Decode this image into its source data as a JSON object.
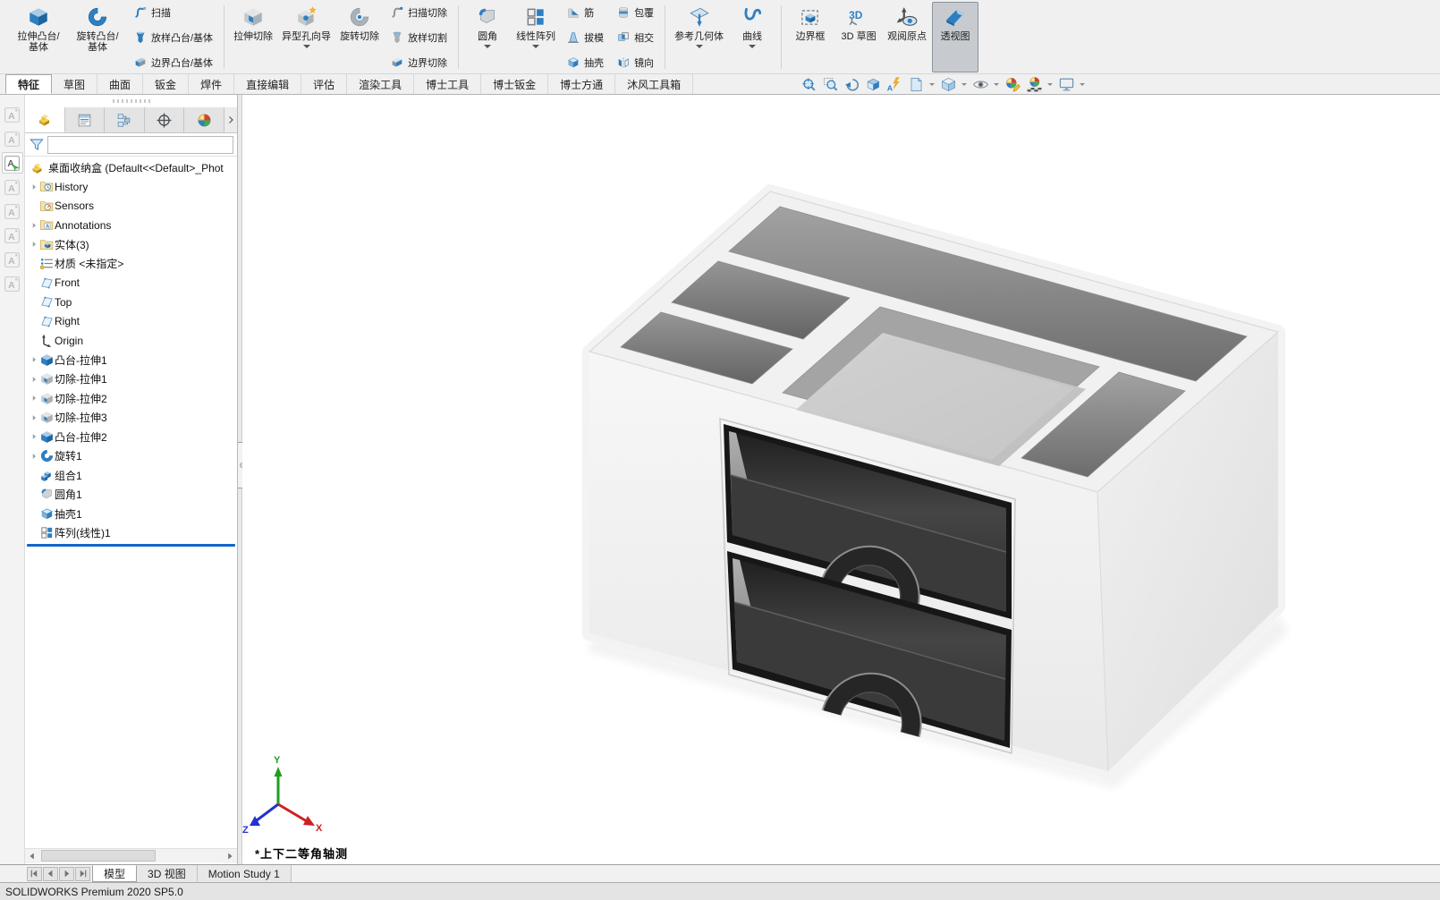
{
  "app": {
    "status_left": "SOLIDWORKS Premium 2020 SP5.0",
    "colors": {
      "accent_blue": "#2e7fc2",
      "rollback_bar": "#1464c8",
      "pressed_button_bg": "#c7cbcf"
    }
  },
  "ribbon": {
    "groups": [
      {
        "items": [
          {
            "type": "big",
            "icon": "boss-extrude",
            "label": "拉伸凸台/基体"
          },
          {
            "type": "big",
            "icon": "revolve-boss",
            "label": "旋转凸台/基体"
          },
          {
            "type": "stack",
            "rows": [
              {
                "icon": "sweep",
                "label": "扫描"
              },
              {
                "icon": "loft",
                "label": "放样凸台/基体"
              },
              {
                "icon": "boundary",
                "label": "边界凸台/基体"
              }
            ]
          }
        ]
      },
      {
        "items": [
          {
            "type": "big",
            "icon": "cut-extrude",
            "label": "拉伸切除"
          },
          {
            "type": "big",
            "icon": "hole-wizard",
            "label": "异型孔向导",
            "dropdown": true
          },
          {
            "type": "big",
            "icon": "revolve-cut",
            "label": "旋转切除"
          },
          {
            "type": "stack",
            "rows": [
              {
                "icon": "sweep-cut",
                "label": "扫描切除"
              },
              {
                "icon": "loft-cut",
                "label": "放样切割"
              },
              {
                "icon": "boundary-cut",
                "label": "边界切除"
              }
            ]
          }
        ]
      },
      {
        "items": [
          {
            "type": "big",
            "icon": "fillet",
            "label": "圆角",
            "dropdown": true
          },
          {
            "type": "big",
            "icon": "linear-pattern",
            "label": "线性阵列",
            "dropdown": true
          },
          {
            "type": "stack",
            "rows": [
              {
                "icon": "rib",
                "label": "筋"
              },
              {
                "icon": "draft",
                "label": "拔模"
              },
              {
                "icon": "shell",
                "label": "抽壳"
              }
            ]
          },
          {
            "type": "stack",
            "rows": [
              {
                "icon": "wrap",
                "label": "包覆"
              },
              {
                "icon": "intersect",
                "label": "相交"
              },
              {
                "icon": "mirror",
                "label": "镜向"
              }
            ]
          }
        ]
      },
      {
        "items": [
          {
            "type": "big",
            "icon": "reference-geometry",
            "label": "参考几何体",
            "dropdown": true
          },
          {
            "type": "big",
            "icon": "curves",
            "label": "曲线",
            "dropdown": true
          }
        ]
      },
      {
        "items": [
          {
            "type": "big",
            "icon": "bounding-box",
            "label": "边界框"
          },
          {
            "type": "big",
            "icon": "sketch3d",
            "label": "3D 草图"
          },
          {
            "type": "big",
            "icon": "view-origin",
            "label": "观阅原点"
          },
          {
            "type": "big",
            "icon": "perspective",
            "label": "透视图",
            "pressed": true
          }
        ]
      }
    ],
    "tabs": [
      "特征",
      "草图",
      "曲面",
      "钣金",
      "焊件",
      "直接编辑",
      "评估",
      "渲染工具",
      "博士工具",
      "博士钣金",
      "博士方通",
      "沐风工具箱"
    ],
    "active_tab_index": 0
  },
  "headsup_toolbar": [
    {
      "name": "zoom-to-fit",
      "icon": "hu-zoomfit"
    },
    {
      "name": "zoom-to-area",
      "icon": "hu-zoomarea"
    },
    {
      "name": "previous-view",
      "icon": "hu-prev"
    },
    {
      "name": "section-view",
      "icon": "hu-section"
    },
    {
      "name": "dynamic-annotation-views",
      "icon": "hu-annview"
    },
    {
      "name": "drawing-view",
      "icon": "hu-page",
      "dropdown": true
    },
    {
      "name": "view-orientation",
      "icon": "hu-cube",
      "dropdown": true
    },
    {
      "name": "hide-show-items",
      "icon": "hu-eye",
      "dropdown": true
    },
    {
      "name": "edit-appearance",
      "icon": "hu-ballpencil"
    },
    {
      "name": "apply-scene",
      "icon": "hu-ballscene",
      "dropdown": true
    },
    {
      "name": "view-settings",
      "icon": "hu-monitor",
      "dropdown": true
    }
  ],
  "left_toolbar": [
    {
      "name": "note-new",
      "enabled": false
    },
    {
      "name": "note-edit",
      "enabled": false
    },
    {
      "name": "note-insert",
      "enabled": true
    },
    {
      "name": "note-add",
      "enabled": false
    },
    {
      "name": "note-lock",
      "enabled": false
    },
    {
      "name": "note-book",
      "enabled": false
    },
    {
      "name": "note-frame",
      "enabled": false
    },
    {
      "name": "note-link",
      "enabled": false
    }
  ],
  "panel": {
    "tabs": [
      {
        "name": "featuremanager",
        "icon": "pm-feature",
        "active": true
      },
      {
        "name": "propertymanager",
        "icon": "pm-props",
        "active": false
      },
      {
        "name": "configurationmanager",
        "icon": "pm-config",
        "active": false
      },
      {
        "name": "dimxpertmanager",
        "icon": "pm-dimx",
        "active": false
      },
      {
        "name": "displaymanager",
        "icon": "pm-display",
        "active": false
      }
    ],
    "filter_value": "",
    "root_label": "桌面收纳盒 (Default<<Default>_Phot",
    "tree_items": [
      {
        "label": "History",
        "icon": "folder-history",
        "expandable": true
      },
      {
        "label": "Sensors",
        "icon": "sensors",
        "expandable": false
      },
      {
        "label": "Annotations",
        "icon": "annotations",
        "expandable": true
      },
      {
        "label": "实体(3)",
        "icon": "bodies-folder",
        "expandable": true
      },
      {
        "label": "材质 <未指定>",
        "icon": "material",
        "expandable": false
      },
      {
        "label": "Front",
        "icon": "plane",
        "expandable": false
      },
      {
        "label": "Top",
        "icon": "plane",
        "expandable": false
      },
      {
        "label": "Right",
        "icon": "plane",
        "expandable": false
      },
      {
        "label": "Origin",
        "icon": "origin",
        "expandable": false
      },
      {
        "label": "凸台-拉伸1",
        "icon": "boss-extrude",
        "expandable": true
      },
      {
        "label": "切除-拉伸1",
        "icon": "cut-extrude",
        "expandable": true
      },
      {
        "label": "切除-拉伸2",
        "icon": "cut-extrude",
        "expandable": true
      },
      {
        "label": "切除-拉伸3",
        "icon": "cut-extrude",
        "expandable": true
      },
      {
        "label": "凸台-拉伸2",
        "icon": "boss-extrude",
        "expandable": true
      },
      {
        "label": "旋转1",
        "icon": "revolve-boss",
        "expandable": true
      },
      {
        "label": "组合1",
        "icon": "combine",
        "expandable": false
      },
      {
        "label": "圆角1",
        "icon": "fillet",
        "expandable": false
      },
      {
        "label": "抽壳1",
        "icon": "shell",
        "expandable": false
      },
      {
        "label": "阵列(线性)1",
        "icon": "linear-pattern",
        "expandable": false
      }
    ]
  },
  "viewport": {
    "view_label": "*上下二等角轴测",
    "triad": {
      "x_label": "X",
      "y_label": "Y",
      "z_label": "Z",
      "x_color": "#cc2222",
      "y_color": "#1e9e1e",
      "z_color": "#2233cc"
    },
    "model_colors": {
      "body": "#f3f3f3",
      "compartment_dark": "#6e6e6e",
      "tray_floor": "#c9c9c9",
      "drawer_front": "#333333",
      "drawer_frame": "#191919"
    }
  },
  "bottom_bar": {
    "nav_buttons": [
      "first",
      "prev",
      "next",
      "last"
    ],
    "tabs": [
      "模型",
      "3D 视图",
      "Motion Study 1"
    ],
    "active_tab_index": 0
  }
}
